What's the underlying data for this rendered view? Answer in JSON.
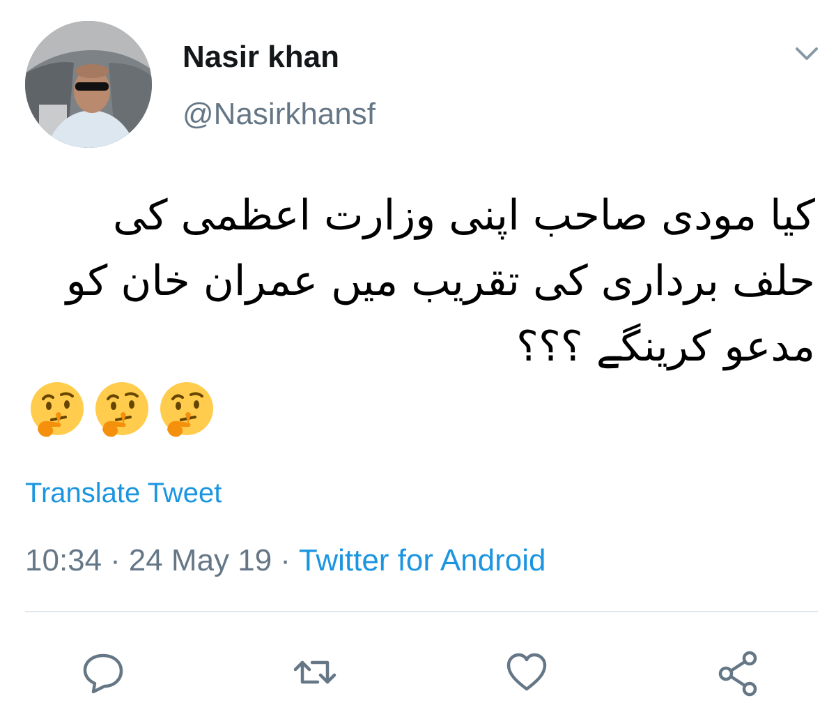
{
  "author": {
    "display_name": "Nasir khan",
    "handle": "@Nasirkhansf"
  },
  "tweet": {
    "text_lines": [
      "کیا مودی صاحب اپنی وزارت اعظمی کی",
      "حلف برداری کی تقریب میں عمران خان کو",
      "مدعو کرینگے ؟؟؟"
    ],
    "emojis": [
      "thinking-face-icon",
      "thinking-face-icon",
      "thinking-face-icon"
    ],
    "translate_label": "Translate Tweet",
    "time": "10:34",
    "separator": "·",
    "date": "24 May 19",
    "source": "Twitter for Android"
  },
  "actions": {
    "icons": [
      "reply-icon",
      "retweet-icon",
      "like-icon",
      "share-icon"
    ]
  },
  "colors": {
    "link": "#1b95e0",
    "secondary_text": "#657786",
    "primary_text": "#14171a",
    "divider": "#e1e8ed",
    "emoji_face": "#ffcc4d",
    "emoji_hand": "#f4900c"
  }
}
